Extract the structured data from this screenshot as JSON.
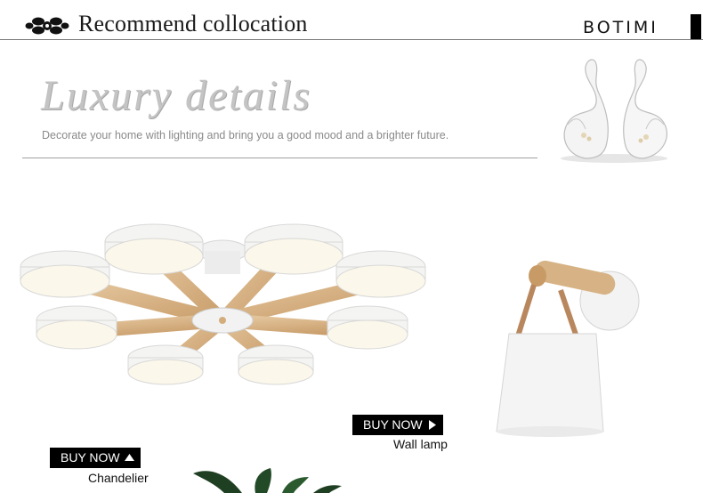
{
  "header": {
    "title": "Recommend collocation",
    "brand": "BOTIMI",
    "ornament_icon": "floral-ornament-icon"
  },
  "banner": {
    "headline": "Luxury details",
    "tagline": "Decorate your home with lighting and bring you a good mood and a brighter future."
  },
  "products": [
    {
      "button_label": "BUY NOW",
      "name": "Wall lamp",
      "arrow_icon": "triangle-right-icon"
    },
    {
      "button_label": "BUY NOW",
      "name": "Chandelier",
      "arrow_icon": "triangle-up-icon"
    }
  ],
  "colors": {
    "accent": "#000000",
    "wood": "#d9b68a",
    "shade": "#f2f2f0",
    "strap": "#b9875d"
  }
}
